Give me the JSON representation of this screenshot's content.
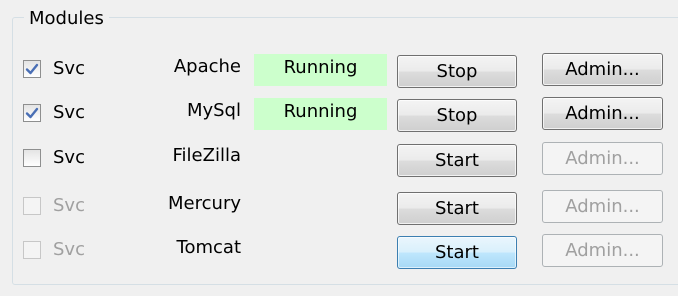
{
  "modules": {
    "title": "Modules",
    "rows": [
      {
        "svc_label": "Svc",
        "checked": true,
        "enabled": true,
        "module": "Apache",
        "status": "Running",
        "action_label": "Stop",
        "admin_label": "Admin...",
        "admin_enabled": true
      },
      {
        "svc_label": "Svc",
        "checked": true,
        "enabled": true,
        "module": "MySql",
        "status": "Running",
        "action_label": "Stop",
        "admin_label": "Admin...",
        "admin_enabled": true
      },
      {
        "svc_label": "Svc",
        "checked": false,
        "enabled": true,
        "module": "FileZilla",
        "status": "",
        "action_label": "Start",
        "admin_label": "Admin...",
        "admin_enabled": false
      },
      {
        "svc_label": "Svc",
        "checked": false,
        "enabled": false,
        "module": "Mercury",
        "status": "",
        "action_label": "Start",
        "admin_label": "Admin...",
        "admin_enabled": false
      },
      {
        "svc_label": "Svc",
        "checked": false,
        "enabled": false,
        "module": "Tomcat",
        "status": "",
        "action_label": "Start",
        "admin_label": "Admin...",
        "admin_enabled": false
      }
    ]
  },
  "colors": {
    "running_bg": "#ccffcc",
    "check_mark": "#4a6fb5",
    "focused_button": "#bee6fd"
  },
  "icons": {
    "checkbox_checked": "check-icon"
  }
}
